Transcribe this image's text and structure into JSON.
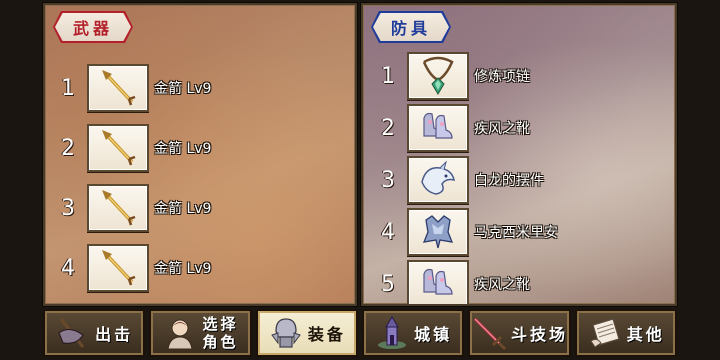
{
  "weapons": {
    "tab_label": "武器",
    "items": [
      {
        "num": "1",
        "name": "金箭 Lv9",
        "icon": "golden-arrow-icon"
      },
      {
        "num": "2",
        "name": "金箭 Lv9",
        "icon": "golden-arrow-icon"
      },
      {
        "num": "3",
        "name": "金箭 Lv9",
        "icon": "golden-arrow-icon"
      },
      {
        "num": "4",
        "name": "金箭 Lv9",
        "icon": "golden-arrow-icon"
      }
    ]
  },
  "armor": {
    "tab_label": "防具",
    "items": [
      {
        "num": "1",
        "name": "修炼项链",
        "icon": "necklace-icon"
      },
      {
        "num": "2",
        "name": "疾风之靴",
        "icon": "boots-icon"
      },
      {
        "num": "3",
        "name": "白龙的摆件",
        "icon": "white-dragon-icon"
      },
      {
        "num": "4",
        "name": "马克西米里安",
        "icon": "maximilian-armor-icon"
      },
      {
        "num": "5",
        "name": "疾风之靴",
        "icon": "boots-icon"
      }
    ]
  },
  "nav": {
    "sortie": "出击",
    "select_line1": "选择",
    "select_line2": "角色",
    "equip": "装备",
    "town": "城镇",
    "arena": "斗技场",
    "other": "其他"
  },
  "colors": {
    "weapon_tab": "#b3202a",
    "armor_tab": "#1f3c9a",
    "active_nav": "#f6efd6"
  }
}
